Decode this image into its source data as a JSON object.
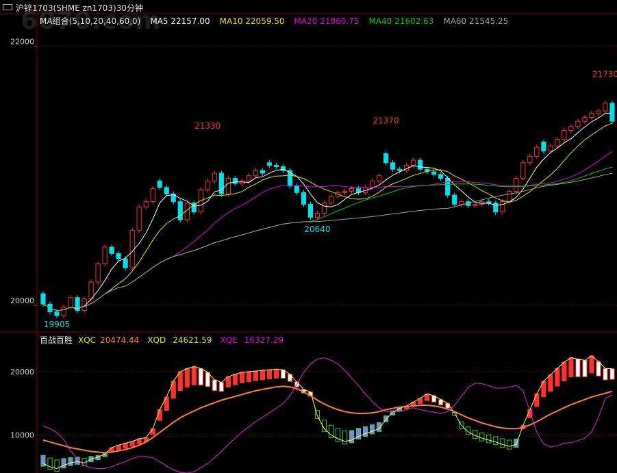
{
  "window": {
    "title": "沪锌1703(SHME zn1703)30分钟",
    "watermark": "6070.com"
  },
  "colors": {
    "background": "#000000",
    "up": "#ff3030",
    "down": "#00e0e8",
    "ma5": "#ffffff",
    "ma10": "#e6e600",
    "ma20": "#e000e0",
    "ma40": "#00d000",
    "ma60": "#a0a0a0",
    "xqc_line": "#ffff60",
    "xqd_line": "#ff8030",
    "xqe_line": "#e020e0",
    "grid": "#800000"
  },
  "main_legend": {
    "group": "MA组合(5,10,20,40,60,0)",
    "ma5": "MA5 22157.00",
    "ma10": "MA10 22059.50",
    "ma20": "MA20 21860.75",
    "ma40": "MA40 21602.63",
    "ma60": "MA60 21545.25"
  },
  "sub_legend": {
    "name": "百战百胜",
    "xqc_label": "XQC",
    "xqc_value": "20474.44",
    "xqd_label": "XQD",
    "xqd_value": "24621.59",
    "xqe_label": "XQE",
    "xqe_value": "16327.29"
  },
  "chart_data": [
    {
      "type": "candlestick",
      "y_axis_ticks": [
        22000,
        20000
      ],
      "ylim": [
        19800,
        22250
      ],
      "annotations": [
        {
          "index": 24,
          "label": "21330",
          "value": 21330,
          "color": "#ff3030"
        },
        {
          "index": 50,
          "label": "21370",
          "value": 21370,
          "color": "#ff3030"
        },
        {
          "index": 40,
          "label": "20640",
          "value": 20640,
          "color": "#00e0e8"
        },
        {
          "index": 82,
          "label": "21730",
          "value": 21730,
          "color": "#ff3030"
        },
        {
          "index": 2,
          "label": "19905",
          "value": 19905,
          "color": "#00e0e8"
        }
      ],
      "close": [
        20010,
        19950,
        19920,
        19985,
        20060,
        19960,
        20050,
        20180,
        20320,
        20450,
        20400,
        20360,
        20290,
        20580,
        20760,
        20800,
        20900,
        20910,
        20860,
        20800,
        20660,
        20790,
        20720,
        20890,
        20960,
        21020,
        20860,
        20980,
        20940,
        20960,
        21000,
        21040,
        21020,
        21080,
        21070,
        21040,
        20920,
        20870,
        20780,
        20680,
        20710,
        20790,
        20840,
        20870,
        20880,
        20900,
        20870,
        20910,
        20960,
        21000,
        21100,
        21050,
        21040,
        21080,
        21120,
        21050,
        21030,
        21010,
        20980,
        20850,
        20780,
        20800,
        20770,
        20780,
        20800,
        20790,
        20720,
        20800,
        20880,
        20980,
        21100,
        21150,
        21220,
        21190,
        21230,
        21280,
        21350,
        21380,
        21420,
        21450,
        21480,
        21500,
        21560,
        21420
      ],
      "open": [
        20090,
        20010,
        19950,
        19920,
        19985,
        20060,
        19960,
        20050,
        20180,
        20320,
        20450,
        20400,
        20360,
        20290,
        20580,
        20760,
        20800,
        20960,
        20910,
        20860,
        20800,
        20660,
        20790,
        20720,
        20890,
        20960,
        21020,
        20860,
        20980,
        20940,
        20960,
        21000,
        21040,
        21100,
        21080,
        21070,
        21040,
        20920,
        20870,
        20780,
        20680,
        20710,
        20790,
        20840,
        20870,
        20880,
        20900,
        20870,
        20910,
        20960,
        21170,
        21100,
        21050,
        21040,
        21080,
        21120,
        21050,
        21030,
        21010,
        20980,
        20850,
        20780,
        20800,
        20770,
        20780,
        20800,
        20790,
        20720,
        20800,
        20880,
        20980,
        21100,
        21150,
        21260,
        21190,
        21230,
        21280,
        21350,
        21380,
        21420,
        21450,
        21480,
        21500,
        21560
      ]
    },
    {
      "type": "bar+line",
      "name_label": "百战百胜",
      "y_axis_ticks": [
        20000,
        10000
      ],
      "ylim": [
        4000,
        24000
      ],
      "bars": [
        5500,
        5000,
        4700,
        5200,
        5600,
        5800,
        5600,
        6200,
        6500,
        7000,
        8000,
        8400,
        8700,
        9000,
        9400,
        9600,
        11000,
        14000,
        16000,
        18500,
        20000,
        20500,
        20800,
        20500,
        19900,
        18700,
        18300,
        19200,
        19600,
        19900,
        20000,
        20100,
        20200,
        20300,
        20400,
        20300,
        19600,
        18400,
        17200,
        16800,
        13000,
        11000,
        10000,
        9400,
        9000,
        9200,
        9800,
        10200,
        10600,
        11000,
        12500,
        13600,
        14200,
        14600,
        15200,
        15800,
        16500,
        16200,
        15600,
        15000,
        13500,
        11500,
        10500,
        9900,
        9500,
        9200,
        8900,
        8500,
        8200,
        8500,
        11500,
        14000,
        16500,
        18500,
        19500,
        20500,
        21500,
        22200,
        22000,
        21800,
        22500,
        21600,
        20500,
        20474
      ],
      "xqd": [
        9200,
        8900,
        8600,
        8300,
        8000,
        7800,
        7600,
        7400,
        7300,
        7200,
        7300,
        7500,
        7700,
        8000,
        8400,
        8900,
        9600,
        10400,
        11200,
        12000,
        12700,
        13300,
        13800,
        14300,
        14700,
        15100,
        15500,
        15800,
        16100,
        16400,
        16700,
        17000,
        17200,
        17400,
        17600,
        17700,
        17600,
        17300,
        16800,
        16200,
        15500,
        14900,
        14400,
        14000,
        13700,
        13500,
        13400,
        13400,
        13500,
        13700,
        14000,
        14200,
        14400,
        14500,
        14600,
        14700,
        14700,
        14600,
        14400,
        14100,
        13700,
        13200,
        12700,
        12300,
        11900,
        11600,
        11300,
        11100,
        11000,
        11000,
        11200,
        11600,
        12100,
        12700,
        13300,
        13800,
        14300,
        14800,
        15200,
        15600,
        16000,
        16300,
        16600,
        16900
      ],
      "xqe": [
        11400,
        11000,
        10400,
        9300,
        7500,
        6200,
        5200,
        4800,
        4700,
        4700,
        5000,
        5400,
        5800,
        6300,
        6600,
        6600,
        6400,
        5800,
        5100,
        4500,
        4100,
        4000,
        4200,
        4800,
        5500,
        6400,
        7400,
        8500,
        9500,
        10500,
        11300,
        12100,
        12800,
        13500,
        14200,
        15000,
        16200,
        18000,
        19900,
        21200,
        22000,
        22200,
        21800,
        21200,
        20200,
        19000,
        17800,
        16500,
        15300,
        14300,
        13700,
        13600,
        13700,
        14000,
        14300,
        14000,
        13800,
        13600,
        13400,
        13700,
        14700,
        16100,
        17500,
        18200,
        18100,
        17800,
        17400,
        17400,
        17600,
        17800,
        17000,
        13700,
        10400,
        8600,
        8100,
        8300,
        8700,
        8800,
        9100,
        9500,
        10500,
        12800,
        15800,
        16327
      ]
    }
  ]
}
